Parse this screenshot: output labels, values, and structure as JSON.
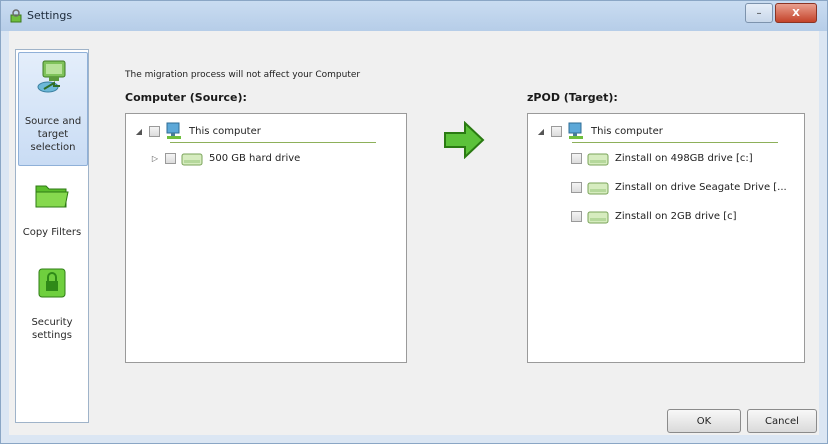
{
  "window": {
    "title": "Settings",
    "minimize_label": "–",
    "close_label": "X"
  },
  "sidebar": {
    "items": [
      {
        "label": "Source and target selection",
        "icon": "computer-transfer-icon",
        "selected": true
      },
      {
        "label": "Copy Filters",
        "icon": "folder-icon",
        "selected": false
      },
      {
        "label": "Security settings",
        "icon": "lock-icon",
        "selected": false
      }
    ]
  },
  "main": {
    "info_text": "The migration process will not affect your Computer",
    "source": {
      "label": "Computer (Source):",
      "root": "This computer",
      "items": [
        "500 GB hard drive"
      ]
    },
    "target": {
      "label": "zPOD (Target):",
      "root": "This computer",
      "items": [
        "Zinstall on 498GB drive [c:]",
        "Zinstall on drive Seagate Drive [...",
        "Zinstall on 2GB drive [c]"
      ]
    }
  },
  "footer": {
    "ok_label": "OK",
    "cancel_label": "Cancel"
  },
  "colors": {
    "accent_green": "#5cc23a",
    "selection_blue": "#c9dcf4"
  }
}
